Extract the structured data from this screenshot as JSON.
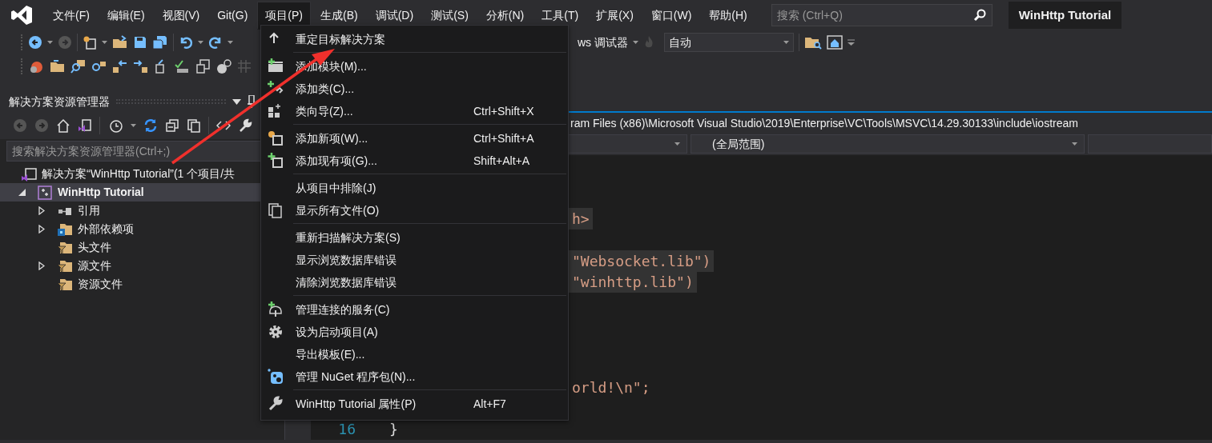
{
  "menubar": [
    {
      "label": "文件(F)",
      "selected": false
    },
    {
      "label": "编辑(E)",
      "selected": false
    },
    {
      "label": "视图(V)",
      "selected": false
    },
    {
      "label": "Git(G)",
      "selected": false
    },
    {
      "label": "项目(P)",
      "selected": true
    },
    {
      "label": "生成(B)",
      "selected": false
    },
    {
      "label": "调试(D)",
      "selected": false
    },
    {
      "label": "测试(S)",
      "selected": false
    },
    {
      "label": "分析(N)",
      "selected": false
    },
    {
      "label": "工具(T)",
      "selected": false
    },
    {
      "label": "扩展(X)",
      "selected": false
    },
    {
      "label": "窗口(W)",
      "selected": false
    },
    {
      "label": "帮助(H)",
      "selected": false
    }
  ],
  "search": {
    "placeholder": "搜索 (Ctrl+Q)"
  },
  "window": {
    "title": "WinHttp Tutorial"
  },
  "toolbar": {
    "debugger_label": "ws 调试器",
    "config_combo": "自动"
  },
  "solution_explorer": {
    "title": "解决方案资源管理器",
    "search": {
      "placeholder": "搜索解决方案资源管理器(Ctrl+;)"
    },
    "tree": [
      {
        "kind": "solution",
        "label": "解决方案“WinHttp Tutorial”(1 个项目/共",
        "selected": false,
        "children": [
          {
            "kind": "project",
            "label": "WinHttp Tutorial",
            "selected": true,
            "expanded": true,
            "children": [
              {
                "kind": "references",
                "label": "引用",
                "selected": false,
                "expanded": false
              },
              {
                "kind": "dependencies",
                "label": "外部依赖项",
                "selected": false,
                "expanded": false
              },
              {
                "kind": "filter",
                "label": "头文件",
                "selected": false
              },
              {
                "kind": "filter",
                "label": "源文件",
                "selected": false,
                "expanded": false
              },
              {
                "kind": "filter",
                "label": "资源文件",
                "selected": false
              }
            ]
          }
        ]
      }
    ]
  },
  "editor": {
    "file_path": "ram Files (x86)\\Microsoft Visual Studio\\2019\\Enterprise\\VC\\Tools\\MSVC\\14.29.30133\\include\\iostream",
    "scope_combo": "(全局范围)",
    "lines": [
      {
        "kind": "clipped",
        "text": "h>",
        "highlighted": true
      },
      {
        "kind": "clipped",
        "text": "\"Websocket.lib\")",
        "highlighted": true
      },
      {
        "kind": "clipped",
        "text": "\"winhttp.lib\")",
        "highlighted": true
      },
      {
        "kind": "clipped",
        "text": "orld!\\n\";",
        "highlighted": false
      },
      {
        "kind": "full",
        "number": "16",
        "text": "}",
        "highlighted": false
      }
    ]
  },
  "project_menu": {
    "groups": [
      [
        {
          "label": "重定目标解决方案"
        }
      ],
      [
        {
          "label": "添加模块(M)..."
        },
        {
          "label": "添加类(C)..."
        },
        {
          "label": "类向导(Z)...",
          "shortcut": "Ctrl+Shift+X"
        }
      ],
      [
        {
          "label": "添加新项(W)...",
          "shortcut": "Ctrl+Shift+A"
        },
        {
          "label": "添加现有项(G)...",
          "shortcut": "Shift+Alt+A"
        }
      ],
      [
        {
          "label": "从项目中排除(J)"
        },
        {
          "label": "显示所有文件(O)"
        }
      ],
      [
        {
          "label": "重新扫描解决方案(S)"
        },
        {
          "label": "显示浏览数据库错误"
        },
        {
          "label": "清除浏览数据库错误"
        }
      ],
      [
        {
          "label": "管理连接的服务(C)"
        },
        {
          "label": "设为启动项目(A)"
        },
        {
          "label": "导出模板(E)..."
        },
        {
          "label": "管理 NuGet 程序包(N)..."
        }
      ],
      [
        {
          "label": "WinHttp Tutorial 属性(P)",
          "shortcut": "Alt+F7"
        }
      ]
    ]
  }
}
